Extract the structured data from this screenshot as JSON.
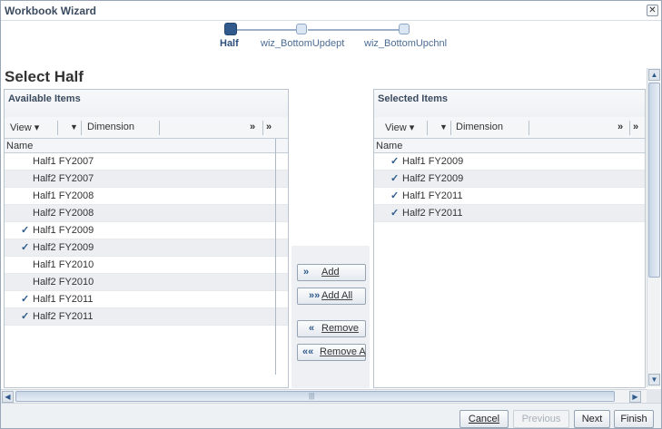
{
  "window": {
    "title": "Workbook Wizard",
    "close_glyph": "✕"
  },
  "train": {
    "stops": [
      {
        "label": "Half",
        "state": "active"
      },
      {
        "label": "wiz_BottomUpdept",
        "state": "pending"
      },
      {
        "label": "wiz_BottomUpchnl",
        "state": "pending"
      }
    ]
  },
  "page_title": "Select Half",
  "available": {
    "title": "Available Items",
    "toolbar": {
      "view": "View ▾",
      "dimension": "Dimension",
      "overflow": "»",
      "overflow2": "»"
    },
    "column": "Name",
    "rows": [
      {
        "label": "Half1 FY2007",
        "checked": ""
      },
      {
        "label": "Half2 FY2007",
        "checked": ""
      },
      {
        "label": "Half1 FY2008",
        "checked": ""
      },
      {
        "label": "Half2 FY2008",
        "checked": ""
      },
      {
        "label": "Half1 FY2009",
        "checked": "✓"
      },
      {
        "label": "Half2 FY2009",
        "checked": "✓"
      },
      {
        "label": "Half1 FY2010",
        "checked": ""
      },
      {
        "label": "Half2 FY2010",
        "checked": ""
      },
      {
        "label": "Half1 FY2011",
        "checked": "✓"
      },
      {
        "label": "Half2 FY2011",
        "checked": "✓"
      }
    ]
  },
  "selected": {
    "title": "Selected Items",
    "toolbar": {
      "view": "View ▾",
      "dimension": "Dimension",
      "overflow": "»",
      "overflow2": "»"
    },
    "column": "Name",
    "rows": [
      {
        "label": "Half1 FY2009",
        "checked": "✓"
      },
      {
        "label": "Half2 FY2009",
        "checked": "✓"
      },
      {
        "label": "Half1 FY2011",
        "checked": "✓"
      },
      {
        "label": "Half2 FY2011",
        "checked": "✓"
      }
    ]
  },
  "shuttle": {
    "add": {
      "icon": "»",
      "label": "Add"
    },
    "add_all": {
      "icon": "»»",
      "label": "Add All"
    },
    "remove": {
      "icon": "«",
      "label": "Remove"
    },
    "remove_all": {
      "icon": "««",
      "label": "Remove A"
    }
  },
  "scroll": {
    "up": "▲",
    "down": "▼",
    "left": "◀",
    "right": "▶",
    "grip": "|||"
  },
  "footer": {
    "cancel": "Cancel",
    "previous": "Previous",
    "next": "Next",
    "finish": "Finish"
  },
  "colors": {
    "accent": "#2f5a8b",
    "row_alt": "#eceef1",
    "border": "#b9c4cf"
  }
}
